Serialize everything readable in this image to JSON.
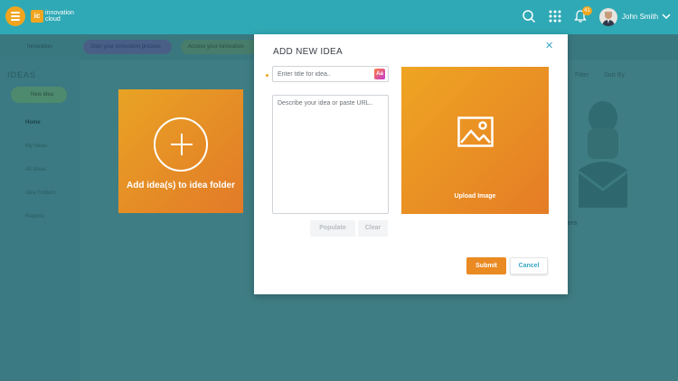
{
  "topbar": {
    "logo_mark": "ic",
    "logo_text": "innovation cloud",
    "notification_count": "41",
    "user_name": "John Smith",
    "colors": {
      "bar": "#2fa9b5",
      "accent": "#f1a51f"
    },
    "icons": [
      "menu-icon",
      "search-icon",
      "apps-grid-icon",
      "bell-icon",
      "chevron-down-icon"
    ]
  },
  "background": {
    "subnav": [
      "Innovation",
      "Start your innovation process",
      "Access your innovation"
    ],
    "sidebar_title": "IDEAS",
    "sidebar_button": "New idea",
    "sidebar_items": [
      "Home",
      "My Ideas",
      "All Ideas",
      "Idea Folders",
      "Reports"
    ],
    "card_label": "Add idea(s) to idea folder",
    "filter": "Filter",
    "sort": "Sort By",
    "illustration_caption": "ers"
  },
  "modal": {
    "title": "ADD NEW IDEA",
    "title_placeholder": "Enter title for idea..",
    "title_value": "",
    "aa_label": "Aa",
    "description_placeholder": "Describe your idea or paste URL..",
    "description_value": "",
    "populate_label": "Populate",
    "clear_label": "Clear",
    "upload_label": "Upload Image",
    "submit_label": "Submit",
    "cancel_label": "Cancel",
    "colors": {
      "orange_start": "#eea522",
      "orange_end": "#e57c26",
      "link": "#3aa6c5"
    }
  }
}
